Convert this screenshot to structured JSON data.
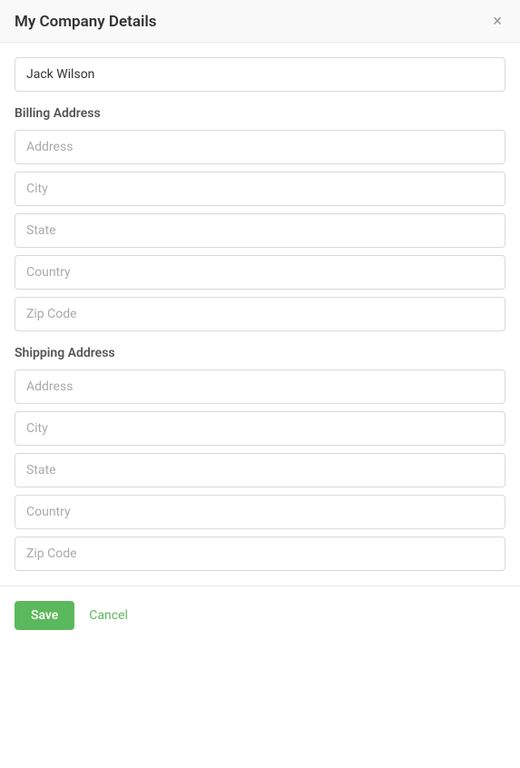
{
  "modal": {
    "title": "My Company Details",
    "close_label": "×"
  },
  "company_name": {
    "value": "Jack Wilson",
    "placeholder": ""
  },
  "billing_address": {
    "label": "Billing Address",
    "fields": {
      "address": {
        "placeholder": "Address",
        "value": ""
      },
      "city": {
        "placeholder": "City",
        "value": ""
      },
      "state": {
        "placeholder": "State",
        "value": ""
      },
      "country": {
        "placeholder": "Country",
        "value": ""
      },
      "zip": {
        "placeholder": "Zip Code",
        "value": ""
      }
    }
  },
  "shipping_address": {
    "label": "Shipping Address",
    "fields": {
      "address": {
        "placeholder": "Address",
        "value": ""
      },
      "city": {
        "placeholder": "City",
        "value": ""
      },
      "state": {
        "placeholder": "State",
        "value": ""
      },
      "country": {
        "placeholder": "Country",
        "value": ""
      },
      "zip": {
        "placeholder": "Zip Code",
        "value": ""
      }
    }
  },
  "footer": {
    "save_label": "Save",
    "cancel_label": "Cancel"
  }
}
